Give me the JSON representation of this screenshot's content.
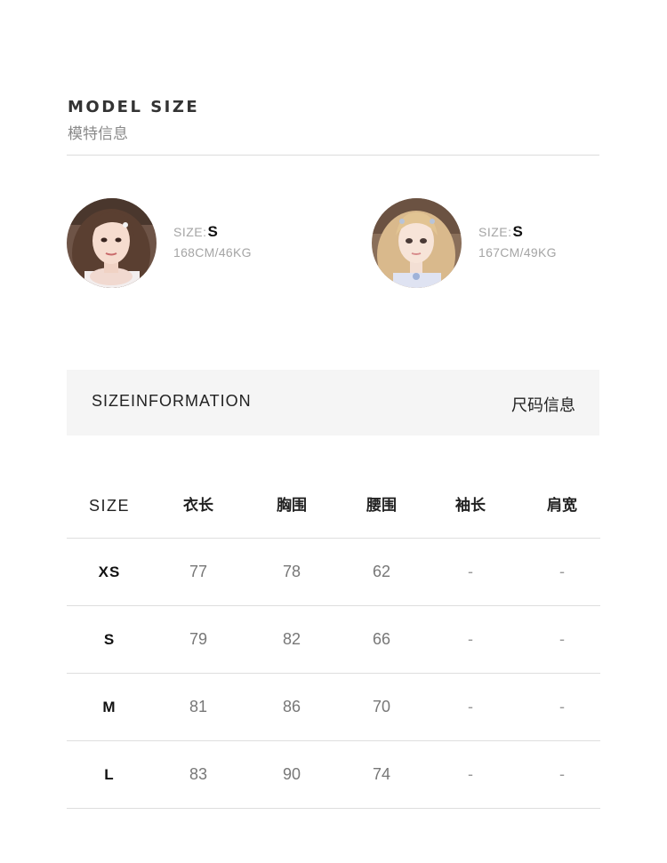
{
  "model_size": {
    "title": "MODEL SIZE",
    "subtitle": "模特信息"
  },
  "models": [
    {
      "size_label": "SIZE:",
      "size_value": "S",
      "stats": "168CM/46KG"
    },
    {
      "size_label": "SIZE:",
      "size_value": "S",
      "stats": "167CM/49KG"
    }
  ],
  "size_info": {
    "left": "SIZEINFORMATION",
    "right": "尺码信息"
  },
  "size_table": {
    "headers": [
      "SIZE",
      "衣长",
      "胸围",
      "腰围",
      "袖长",
      "肩宽"
    ],
    "rows": [
      [
        "XS",
        "77",
        "78",
        "62",
        "-",
        "-"
      ],
      [
        "S",
        "79",
        "82",
        "66",
        "-",
        "-"
      ],
      [
        "M",
        "81",
        "86",
        "70",
        "-",
        "-"
      ],
      [
        "L",
        "83",
        "90",
        "74",
        "-",
        "-"
      ]
    ]
  }
}
